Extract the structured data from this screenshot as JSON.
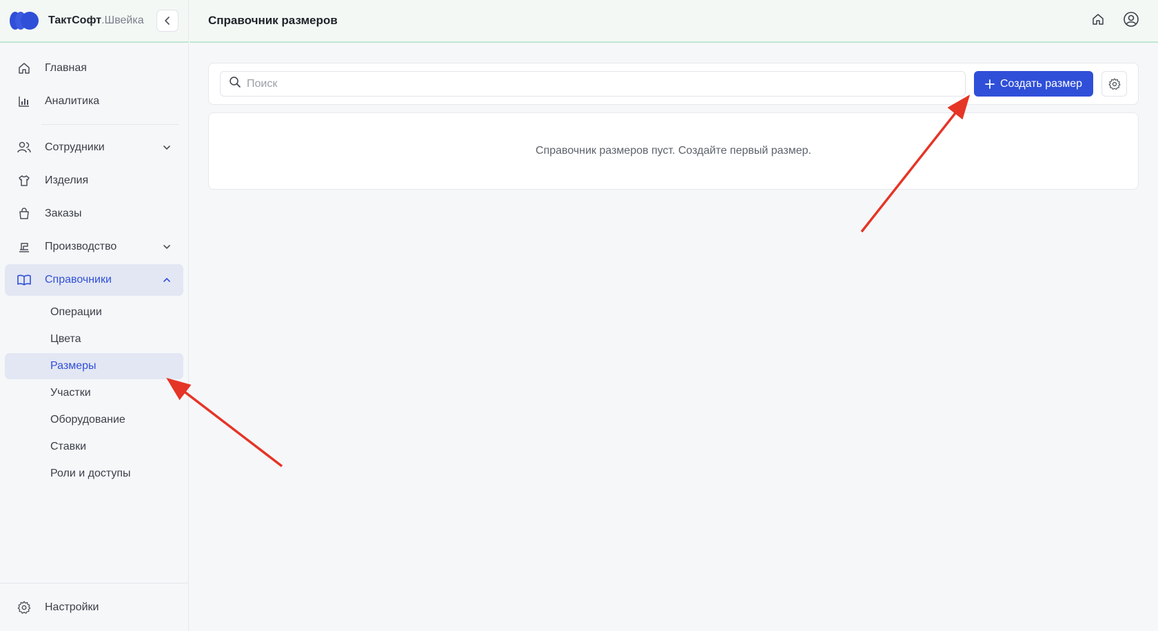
{
  "brand": {
    "name": "ТактСофт",
    "sub": ".Швейка"
  },
  "header": {
    "title": "Справочник размеров"
  },
  "sidebar": {
    "items": [
      {
        "label": "Главная"
      },
      {
        "label": "Аналитика"
      },
      {
        "label": "Сотрудники"
      },
      {
        "label": "Изделия"
      },
      {
        "label": "Заказы"
      },
      {
        "label": "Производство"
      },
      {
        "label": "Справочники"
      }
    ],
    "subitems": [
      {
        "label": "Операции"
      },
      {
        "label": "Цвета"
      },
      {
        "label": "Размеры"
      },
      {
        "label": "Участки"
      },
      {
        "label": "Оборудование"
      },
      {
        "label": "Ставки"
      },
      {
        "label": "Роли и доступы"
      }
    ],
    "settings": "Настройки"
  },
  "search": {
    "placeholder": "Поиск"
  },
  "toolbar": {
    "create_label": "Создать размер"
  },
  "empty": {
    "message": "Справочник размеров пуст. Создайте первый размер."
  },
  "colors": {
    "accent": "#2f4fd8",
    "header_border": "#bfe6d2",
    "annotation": "#e53526"
  }
}
